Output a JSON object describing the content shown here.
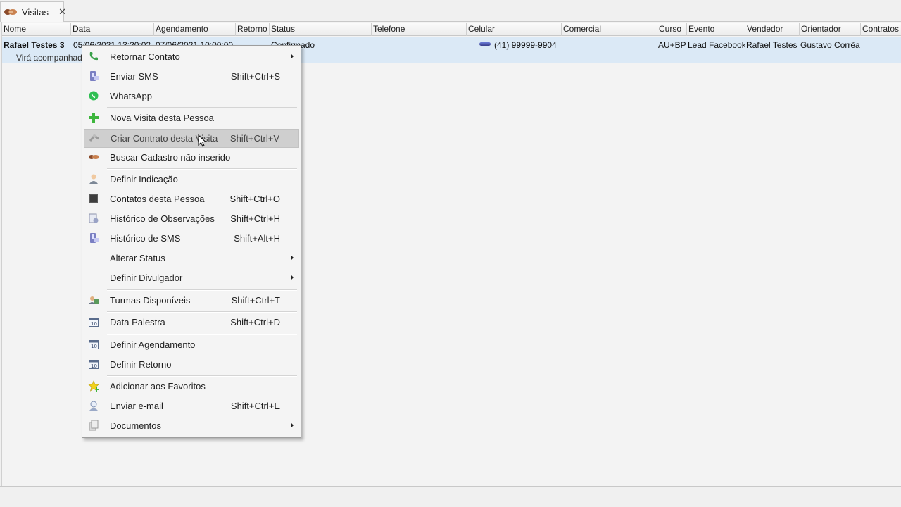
{
  "tab": {
    "label": "Visitas",
    "close": "✕"
  },
  "columns": [
    "Nome",
    "Data",
    "Agendamento",
    "Retorno",
    "Status",
    "Telefone",
    "Celular",
    "Comercial",
    "Curso",
    "Evento",
    "Vendedor",
    "Orientador",
    "Contratos"
  ],
  "row": {
    "nome": "Rafael Testes 3",
    "data": "05/06/2021 13:20:02",
    "agendamento": "07/06/2021 10:00:00",
    "status": "Confirmado",
    "celular": "(41) 99999-9904",
    "curso": "AU+BP",
    "evento": "Lead Facebook",
    "vendedor": "Rafael Testes",
    "orientador": "Gustavo Corrêa",
    "observacao": "Virá acompanhado"
  },
  "menu": {
    "items": [
      {
        "label": "Retornar Contato",
        "shortcut": "",
        "icon": "phone-icon",
        "submenu": true
      },
      {
        "label": "Enviar SMS",
        "shortcut": "Shift+Ctrl+S",
        "icon": "sms-icon",
        "submenu": false
      },
      {
        "label": "WhatsApp",
        "shortcut": "",
        "icon": "whatsapp-icon",
        "submenu": false
      },
      {
        "label": "Nova Visita desta Pessoa",
        "shortcut": "",
        "icon": "plus-icon",
        "submenu": false
      },
      {
        "label": "Criar Contrato desta Visita",
        "shortcut": "Shift+Ctrl+V",
        "icon": "contract-icon",
        "submenu": false
      },
      {
        "label": "Buscar Cadastro não inserido",
        "shortcut": "",
        "icon": "handshake-icon",
        "submenu": false
      },
      {
        "label": "Definir Indicação",
        "shortcut": "",
        "icon": "person-icon",
        "submenu": false
      },
      {
        "label": "Contatos desta Pessoa",
        "shortcut": "Shift+Ctrl+O",
        "icon": "contacts-icon",
        "submenu": false
      },
      {
        "label": "Histórico de Observações",
        "shortcut": "Shift+Ctrl+H",
        "icon": "notes-icon",
        "submenu": false
      },
      {
        "label": "Histórico de SMS",
        "shortcut": "Shift+Alt+H",
        "icon": "sms-history-icon",
        "submenu": false
      },
      {
        "label": "Alterar Status",
        "shortcut": "",
        "icon": "",
        "submenu": true
      },
      {
        "label": "Definir Divulgador",
        "shortcut": "",
        "icon": "",
        "submenu": true
      },
      {
        "label": "Turmas Disponíveis",
        "shortcut": "Shift+Ctrl+T",
        "icon": "classes-icon",
        "submenu": false
      },
      {
        "label": "Data Palestra",
        "shortcut": "Shift+Ctrl+D",
        "icon": "calendar-icon",
        "submenu": false
      },
      {
        "label": "Definir Agendamento",
        "shortcut": "",
        "icon": "calendar-icon",
        "submenu": false
      },
      {
        "label": "Definir Retorno",
        "shortcut": "",
        "icon": "calendar-icon",
        "submenu": false
      },
      {
        "label": "Adicionar aos Favoritos",
        "shortcut": "",
        "icon": "star-icon",
        "submenu": false
      },
      {
        "label": "Enviar e-mail",
        "shortcut": "Shift+Ctrl+E",
        "icon": "email-icon",
        "submenu": false
      },
      {
        "label": "Documentos",
        "shortcut": "",
        "icon": "documents-icon",
        "submenu": true
      }
    ]
  }
}
